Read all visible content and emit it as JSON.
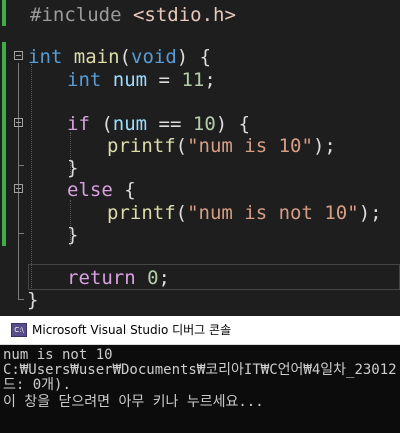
{
  "editor": {
    "lines": [
      {
        "id": "include",
        "tokens": [
          {
            "t": "#include ",
            "c": "pre"
          },
          {
            "t": "<stdio.h>",
            "c": "inc"
          }
        ]
      },
      {
        "id": "blank-1",
        "tokens": []
      },
      {
        "id": "main-signature",
        "tokens": [
          {
            "t": "int",
            "c": "kw"
          },
          {
            "t": " "
          },
          {
            "t": "main",
            "c": "fn"
          },
          {
            "t": "("
          },
          {
            "t": "void",
            "c": "kw"
          },
          {
            "t": ") {"
          }
        ]
      },
      {
        "id": "decl-num",
        "tokens": [
          {
            "t": "int",
            "c": "kw"
          },
          {
            "t": " "
          },
          {
            "t": "num",
            "c": "var"
          },
          {
            "t": " = "
          },
          {
            "t": "11",
            "c": "num"
          },
          {
            "t": ";"
          }
        ]
      },
      {
        "id": "blank-2",
        "tokens": []
      },
      {
        "id": "if-stmt",
        "tokens": [
          {
            "t": "if",
            "c": "kw-ctl"
          },
          {
            "t": " ("
          },
          {
            "t": "num",
            "c": "var"
          },
          {
            "t": " == "
          },
          {
            "t": "10",
            "c": "num"
          },
          {
            "t": ") {"
          }
        ]
      },
      {
        "id": "printf-1",
        "tokens": [
          {
            "t": "printf",
            "c": "fn"
          },
          {
            "t": "("
          },
          {
            "t": "\"num is 10\"",
            "c": "str"
          },
          {
            "t": ");"
          }
        ]
      },
      {
        "id": "if-close",
        "tokens": [
          {
            "t": "}"
          }
        ]
      },
      {
        "id": "else-stmt",
        "tokens": [
          {
            "t": "else",
            "c": "kw-ctl"
          },
          {
            "t": " {"
          }
        ]
      },
      {
        "id": "printf-2",
        "tokens": [
          {
            "t": "printf",
            "c": "fn"
          },
          {
            "t": "("
          },
          {
            "t": "\"num is not 10\"",
            "c": "str"
          },
          {
            "t": ");"
          }
        ]
      },
      {
        "id": "else-close",
        "tokens": [
          {
            "t": "}"
          }
        ]
      },
      {
        "id": "blank-3",
        "tokens": []
      },
      {
        "id": "return-stmt",
        "tokens": [
          {
            "t": "return",
            "c": "kw-ctl"
          },
          {
            "t": " "
          },
          {
            "t": "0",
            "c": "num"
          },
          {
            "t": ";"
          }
        ]
      },
      {
        "id": "main-close",
        "tokens": [
          {
            "t": "}"
          }
        ]
      }
    ]
  },
  "console": {
    "title": "Microsoft Visual Studio 디버그 콘솔",
    "icon": "visual-studio-console-icon",
    "output": [
      "num is not 10",
      "C:₩Users₩user₩Documents₩코리아IT₩C언어₩4일차_23012",
      "드: 0개).",
      "이 창을 닫으려면 아무 키나 누르세요..."
    ]
  },
  "colors": {
    "editor_bg": "#1e1e1e",
    "keyword": "#569cd6",
    "control_keyword": "#d8a0df",
    "function": "#dcdcaa",
    "variable": "#9cdcfe",
    "number": "#b5cea8",
    "string": "#d69d85",
    "change_bar": "#3fae49",
    "console_bg": "#0c0c0c"
  }
}
